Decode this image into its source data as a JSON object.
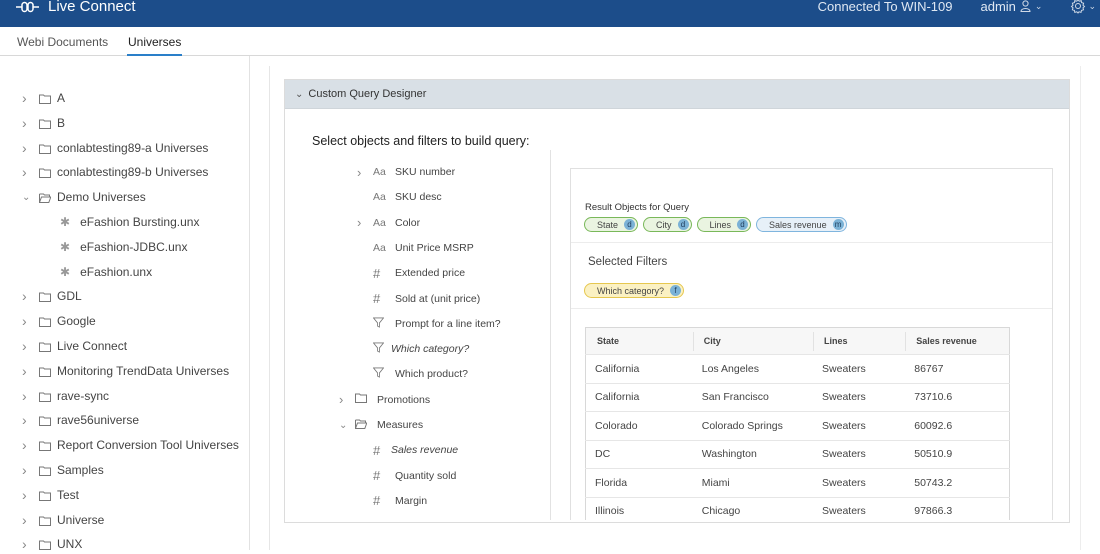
{
  "header": {
    "app_title": "Live Connect",
    "logo_icon": "plug-icon",
    "connection_status": "Connected To WIN-109",
    "user_label": "admin",
    "user_icon": "user-icon",
    "settings_icon": "gear-icon"
  },
  "tabs": [
    {
      "label": "Webi Documents",
      "active": false
    },
    {
      "label": "Universes",
      "active": true
    }
  ],
  "sidebar": {
    "items": [
      {
        "label": "A",
        "expanded": false
      },
      {
        "label": "B",
        "expanded": false
      },
      {
        "label": "conlabtesting89-a Universes",
        "expanded": false
      },
      {
        "label": "conlabtesting89-b Universes",
        "expanded": false
      },
      {
        "label": "Demo Universes",
        "expanded": true,
        "children": [
          {
            "label": "eFashion Bursting.unx"
          },
          {
            "label": "eFashion-JDBC.unx"
          },
          {
            "label": "eFashion.unx"
          }
        ]
      },
      {
        "label": "GDL",
        "expanded": false
      },
      {
        "label": "Google",
        "expanded": false
      },
      {
        "label": "Live Connect",
        "expanded": false
      },
      {
        "label": "Monitoring TrendData Universes",
        "expanded": false
      },
      {
        "label": "rave-sync",
        "expanded": false
      },
      {
        "label": "rave56universe",
        "expanded": false
      },
      {
        "label": "Report Conversion Tool Universes",
        "expanded": false
      },
      {
        "label": "Samples",
        "expanded": false
      },
      {
        "label": "Test",
        "expanded": false
      },
      {
        "label": "Universe",
        "expanded": false
      },
      {
        "label": "UNX",
        "expanded": false
      }
    ]
  },
  "designer": {
    "section_title": "Custom Query Designer",
    "instruction": "Select objects and filters to build query:",
    "objects": [
      {
        "label": "SKU number",
        "type": "dimension",
        "icon": "Aa",
        "expandable": true
      },
      {
        "label": "SKU desc",
        "type": "dimension",
        "icon": "Aa",
        "expandable": false
      },
      {
        "label": "Color",
        "type": "dimension",
        "icon": "Aa",
        "expandable": true
      },
      {
        "label": "Unit Price MSRP",
        "type": "dimension",
        "icon": "Aa",
        "expandable": false
      },
      {
        "label": "Extended price",
        "type": "measure",
        "icon": "#",
        "expandable": false
      },
      {
        "label": "Sold at (unit price)",
        "type": "measure",
        "icon": "#",
        "expandable": false
      },
      {
        "label": "Prompt for a line item?",
        "type": "filter",
        "icon": "funnel",
        "expandable": false
      },
      {
        "label": "Which category?",
        "type": "filter",
        "icon": "funnel",
        "expandable": false,
        "selected": true
      },
      {
        "label": "Which product?",
        "type": "filter",
        "icon": "funnel",
        "expandable": false
      },
      {
        "label": "Promotions",
        "type": "folder",
        "expanded": false
      },
      {
        "label": "Measures",
        "type": "folder",
        "expanded": true
      },
      {
        "label": "Sales revenue",
        "type": "measure",
        "icon": "#",
        "selected": true
      },
      {
        "label": "Quantity sold",
        "type": "measure",
        "icon": "#"
      },
      {
        "label": "Margin",
        "type": "measure",
        "icon": "#"
      }
    ],
    "result_objects_label": "Result Objects for Query",
    "result_objects": [
      {
        "label": "State",
        "badge": "d",
        "kind": "dimension"
      },
      {
        "label": "City",
        "badge": "d",
        "kind": "dimension"
      },
      {
        "label": "Lines",
        "badge": "d",
        "kind": "dimension"
      },
      {
        "label": "Sales revenue",
        "badge": "m",
        "kind": "measure"
      }
    ],
    "filters_label": "Selected Filters",
    "filters": [
      {
        "label": "Which category?",
        "badge": "f"
      }
    ],
    "table": {
      "columns": [
        "State",
        "City",
        "Lines",
        "Sales revenue"
      ],
      "rows": [
        [
          "California",
          "Los Angeles",
          "Sweaters",
          "86767"
        ],
        [
          "California",
          "San Francisco",
          "Sweaters",
          "73710.6"
        ],
        [
          "Colorado",
          "Colorado Springs",
          "Sweaters",
          "60092.6"
        ],
        [
          "DC",
          "Washington",
          "Sweaters",
          "50510.9"
        ],
        [
          "Florida",
          "Miami",
          "Sweaters",
          "50743.2"
        ],
        [
          "Illinois",
          "Chicago",
          "Sweaters",
          "97866.3"
        ]
      ]
    }
  },
  "colors": {
    "header_bg": "#1c4d8a",
    "tab_underline": "#2a7fc9",
    "dimension_pill": "#79b859",
    "measure_pill": "#7fb5de",
    "filter_pill": "#e6c74f",
    "panel_head_bg": "#d9e0e6"
  }
}
